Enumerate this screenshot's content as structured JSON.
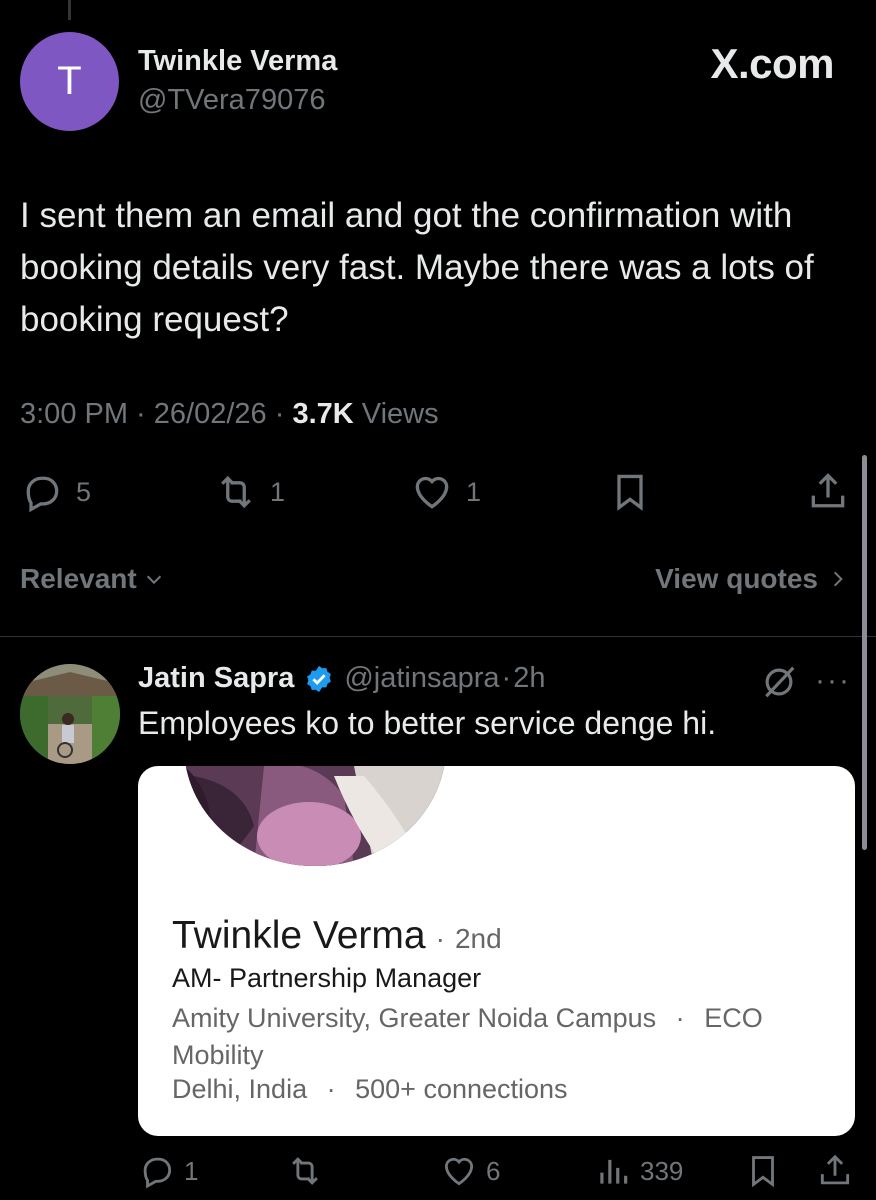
{
  "tweet": {
    "avatar_letter": "T",
    "author_name": "Twinkle Verma",
    "author_handle": "@TVera79076",
    "brand": "X.com",
    "text": "I sent them an email and got the confirmation with booking details very fast. Maybe there was a lots of booking request?",
    "time": "3:00 PM",
    "date": "26/02/26",
    "views_count": "3.7K",
    "views_label": "Views",
    "separator": " · ",
    "stats": {
      "replies": "5",
      "reposts": "1",
      "likes": "1"
    },
    "colors": {
      "avatar_bg": "#7e57c2",
      "muted": "#71767b",
      "verified": "#1d9bf0"
    }
  },
  "filter": {
    "relevant_label": "Relevant",
    "view_quotes_label": "View quotes"
  },
  "reply": {
    "name": "Jatin Sapra",
    "handle": "@jatinsapra",
    "time": "2h",
    "text": "Employees ko to better service denge hi.",
    "card": {
      "name": "Twinkle Verma",
      "degree": "2nd",
      "title": "AM- Partnership Manager",
      "education": "Amity University, Greater Noida Campus",
      "education_extra": "ECO Mobility",
      "location": "Delhi, India",
      "connections": "500+ connections"
    },
    "stats": {
      "replies": "1",
      "likes": "6",
      "views": "339"
    }
  }
}
